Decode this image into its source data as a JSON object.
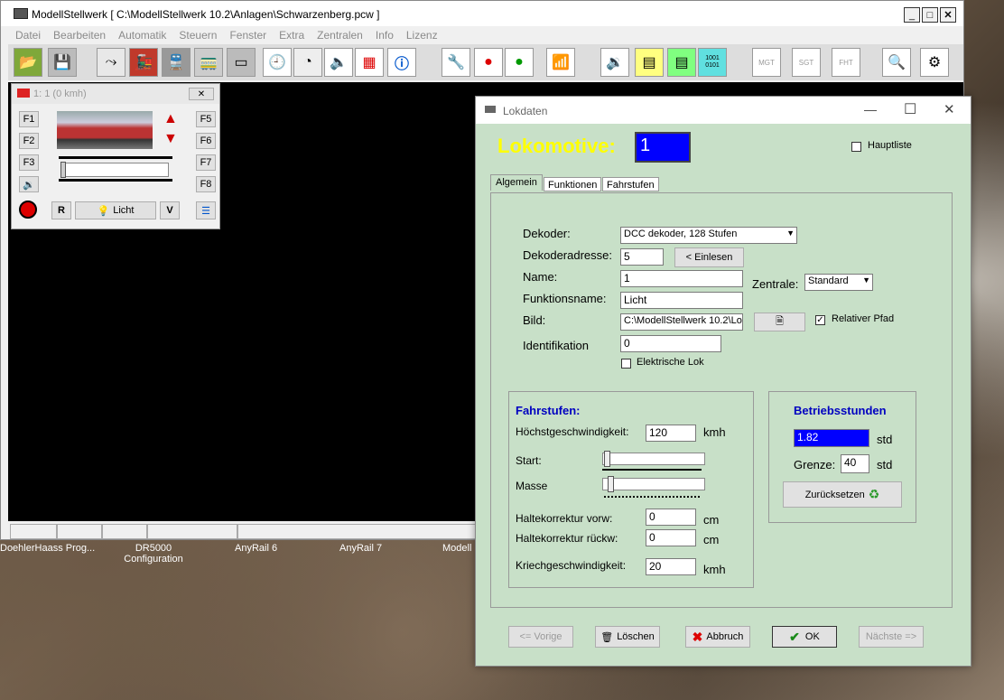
{
  "main_window": {
    "title": "ModellStellwerk [ C:\\ModellStellwerk 10.2\\Anlagen\\Schwarzenberg.pcw ]",
    "menu": [
      "Datei",
      "Bearbeiten",
      "Automatik",
      "Steuern",
      "Fenster",
      "Extra",
      "Zentralen",
      "Info",
      "Lizenz"
    ]
  },
  "toolbar_icons": [
    "open-folder-icon",
    "save-disk-icon",
    "track-switch-icon",
    "locomotive-icon",
    "train-icon",
    "locomotive-list-icon",
    "locomotive-display-icon",
    "clock-icon",
    "speedometer-icon",
    "horn-icon",
    "signal-panel-icon",
    "info-icon",
    "tools-icon",
    "red-signal-icon",
    "green-signal-icon",
    "wifi-icon",
    "sound-icon",
    "chip-yellow-icon",
    "chip-green-icon",
    "binary-icon",
    "mgt-icon",
    "sgt-icon",
    "fht-icon",
    "magnifier-icon",
    "settings-gears-icon"
  ],
  "toolbar_text": {
    "binary": "1001\n0101",
    "mgt": "MGT",
    "sgt": "SGT",
    "fht": "FHT"
  },
  "loco_window": {
    "title": "1: 1 (0 kmh)",
    "f_left": [
      "F1",
      "F2",
      "F3"
    ],
    "f_right": [
      "F5",
      "F6",
      "F7",
      "F8"
    ],
    "r_label": "R",
    "licht_label": "Licht",
    "v_label": "V"
  },
  "desktop_icons": [
    "DoehlerHaass Prog...",
    "DR5000\nConfiguration",
    "AnyRail 6",
    "AnyRail 7",
    "Modell"
  ],
  "dialog": {
    "title": "Lokdaten",
    "heading": "Lokomotive:",
    "loco_number": "1",
    "hauptliste_label": "Hauptliste",
    "tabs": [
      "Algemein",
      "Funktionen",
      "Fahrstufen"
    ],
    "dekoder_label": "Dekoder:",
    "dekoder_value": "DCC dekoder, 128 Stufen",
    "adresse_label": "Dekoderadresse:",
    "adresse_value": "5",
    "einlesen_label": "< Einlesen",
    "name_label": "Name:",
    "name_value": "1",
    "zentrale_label": "Zentrale:",
    "zentrale_value": "Standard",
    "funktionsname_label": "Funktionsname:",
    "funktionsname_value": "Licht",
    "bild_label": "Bild:",
    "bild_value": "C:\\ModellStellwerk 10.2\\Lo",
    "relativer_pfad_label": "Relativer Pfad",
    "relativer_pfad_checked": true,
    "identifikation_label": "Identifikation",
    "identifikation_value": "0",
    "elektrische_lok_label": "Elektrische Lok",
    "fahrstufen_title": "Fahrstufen:",
    "hoechst_label": "Höchstgeschwindigkeit:",
    "hoechst_value": "120",
    "hoechst_unit": "kmh",
    "start_label": "Start:",
    "masse_label": "Masse",
    "halte_vorw_label": "Haltekorrektur vorw:",
    "halte_vorw_value": "0",
    "halte_vorw_unit": "cm",
    "halte_rueck_label": "Haltekorrektur rückw:",
    "halte_rueck_value": "0",
    "halte_rueck_unit": "cm",
    "kriech_label": "Kriechgeschwindigkeit:",
    "kriech_value": "20",
    "kriech_unit": "kmh",
    "betrieb_title": "Betriebsstunden",
    "betrieb_value": "1.82",
    "betrieb_unit": "std",
    "grenze_label": "Grenze:",
    "grenze_value": "40",
    "grenze_unit": "std",
    "reset_label": "Zurücksetzen",
    "btn_vorige": "<= Vorige",
    "btn_loeschen": "Löschen",
    "btn_abbruch": "Abbruch",
    "btn_ok": "OK",
    "btn_naechste": "Nächste =>"
  },
  "colors": {
    "dialog_bg": "#c8e0c8",
    "heading_yellow": "#ffff00",
    "loco_field_blue": "#0000ff",
    "title_blue": "#0000c0"
  }
}
